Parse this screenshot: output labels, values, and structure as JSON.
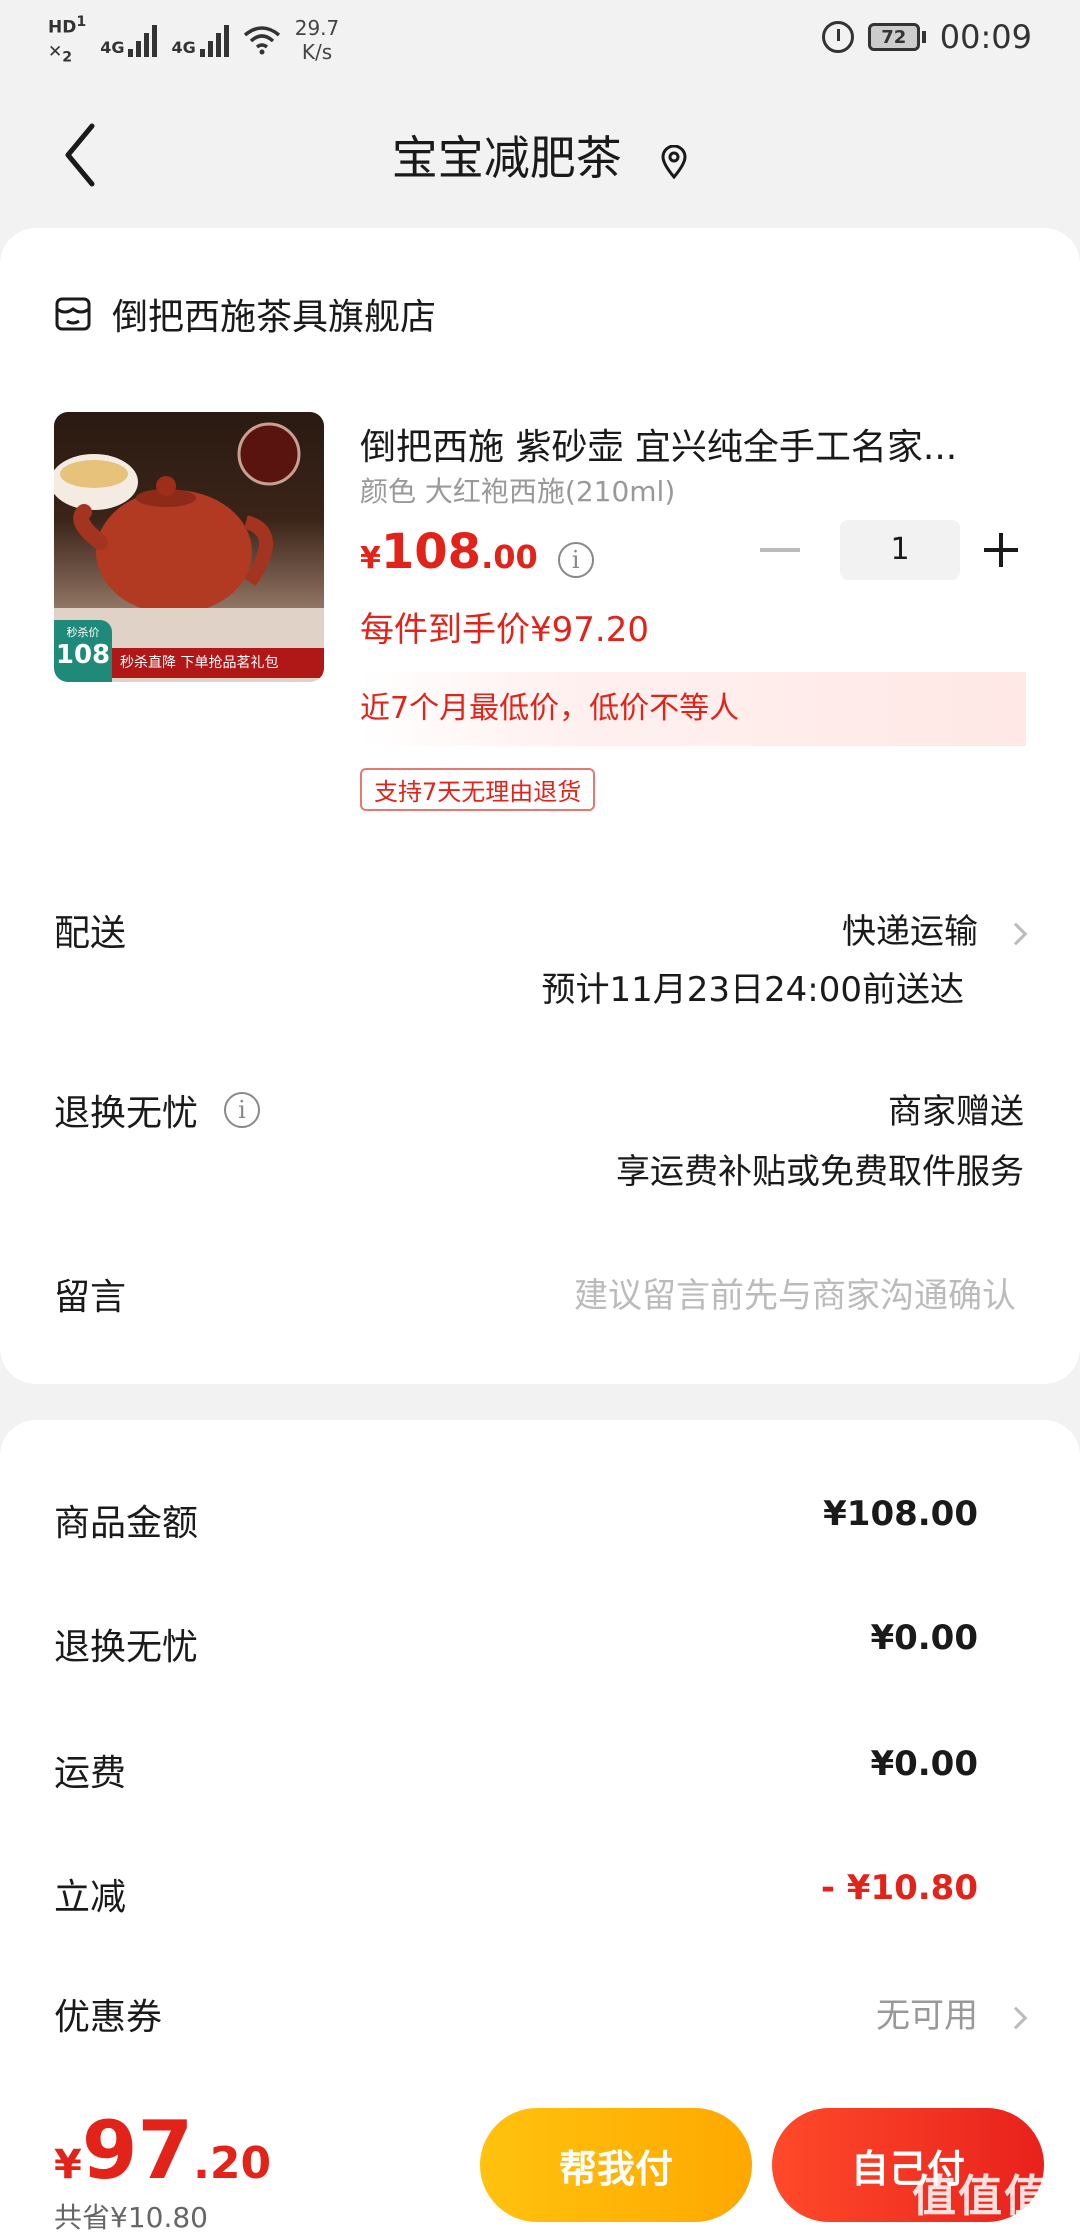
{
  "status_bar": {
    "hd": "HD",
    "sim1": "1",
    "sim2": "2",
    "net1": "4G",
    "net2": "4G",
    "speed_value": "29.7",
    "speed_unit": "K/s",
    "battery": "72",
    "time": "00:09"
  },
  "header": {
    "title": "宝宝减肥茶"
  },
  "shop": {
    "name": "倒把西施茶具旗舰店"
  },
  "product": {
    "title": "倒把西施 紫砂壶 宜兴纯全手工名家...",
    "spec": "颜色 大红袍西施(210ml)",
    "price_currency": "¥",
    "price_int": "108",
    "price_dec": ".00",
    "quantity": "1",
    "per_price": "每件到手价¥97.20",
    "lowest_note": "近7个月最低价，低价不等人",
    "refund_tag": "支持7天无理由退货",
    "image_badge_label": "秒杀价",
    "image_badge_price": "108",
    "image_banner": "秒杀直降 下单抢品茗礼包"
  },
  "delivery": {
    "label": "配送",
    "method": "快递运输",
    "eta": "预计11月23日24:00前送达"
  },
  "returns": {
    "label": "退换无忧",
    "provider": "商家赠送",
    "desc": "享运费补贴或免费取件服务"
  },
  "message": {
    "label": "留言",
    "placeholder": "建议留言前先与商家沟通确认"
  },
  "summary": {
    "goods_label": "商品金额",
    "goods_value": "¥108.00",
    "returns_label": "退换无忧",
    "returns_value": "¥0.00",
    "shipping_label": "运费",
    "shipping_value": "¥0.00",
    "discount_label": "立减",
    "discount_value": "- ¥10.80",
    "coupon_label": "优惠券",
    "coupon_value": "无可用"
  },
  "footer": {
    "total_currency": "¥",
    "total_int": "97",
    "total_dec": ".20",
    "saved": "共省¥10.80",
    "help_pay": "帮我付",
    "self_pay": "自己付",
    "watermark": "值值值",
    "watermark_url": "zhizhizhi.com"
  },
  "colors": {
    "accent_red": "#e2231a",
    "help_button": "#ffb400",
    "self_button": "#ff3b22"
  }
}
